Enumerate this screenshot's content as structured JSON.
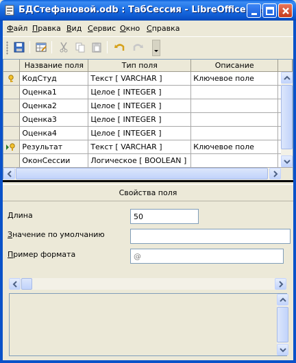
{
  "window": {
    "title": "БДСтефановой.odb : ТабСессия - LibreOffice Bas..."
  },
  "menu": [
    {
      "label": "Файл",
      "accel": "Ф",
      "rest": "айл"
    },
    {
      "label": "Правка",
      "accel": "П",
      "rest": "равка"
    },
    {
      "label": "Вид",
      "accel": "В",
      "rest": "ид"
    },
    {
      "label": "Сервис",
      "accel": "С",
      "rest": "ервис"
    },
    {
      "label": "Окно",
      "accel": "О",
      "rest": "кно"
    },
    {
      "label": "Справка",
      "accel": "С",
      "rest": "правка"
    }
  ],
  "toolbar": {
    "icons": [
      "save-icon",
      "table-design-icon",
      "cut-icon",
      "copy-icon",
      "paste-icon",
      "undo-icon",
      "redo-icon",
      "more-options-icon"
    ]
  },
  "grid": {
    "headers": [
      "Название поля",
      "Тип поля",
      "Описание"
    ],
    "rows": [
      {
        "name": "КодСтуд",
        "type": "Текст [ VARCHAR ]",
        "desc": "Ключевое поле",
        "marker": "primary-key"
      },
      {
        "name": "Оценка1",
        "type": "Целое [ INTEGER ]",
        "desc": "",
        "marker": ""
      },
      {
        "name": "Оценка2",
        "type": "Целое [ INTEGER ]",
        "desc": "",
        "marker": ""
      },
      {
        "name": "Оценка3",
        "type": "Целое [ INTEGER ]",
        "desc": "",
        "marker": ""
      },
      {
        "name": "Оценка4",
        "type": "Целое [ INTEGER ]",
        "desc": "",
        "marker": ""
      },
      {
        "name": "Результат",
        "type": "Текст [ VARCHAR ]",
        "desc": "Ключевое поле",
        "marker": "current-key"
      },
      {
        "name": "ОконСессии",
        "type": "Логическое [ BOOLEAN ]",
        "desc": "",
        "marker": ""
      }
    ]
  },
  "properties": {
    "title": "Свойства поля",
    "length_accel": "Д",
    "length_rest": "лина",
    "length_value": "50",
    "default_accel": "З",
    "default_rest": "начение по умолчанию",
    "default_value": "",
    "format_accel": "П",
    "format_rest": "ример формата",
    "format_value": "@"
  }
}
